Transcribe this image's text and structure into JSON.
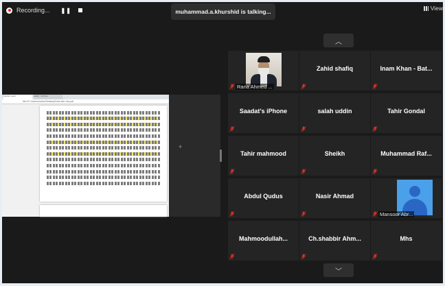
{
  "recording": {
    "label": "Recording..."
  },
  "talking": {
    "text": "muhammad.a.khurshid is talking..."
  },
  "view": {
    "label": "View"
  },
  "share": {
    "tabs": [
      "Vender result",
      "arabic - Archive"
    ],
    "url": "file:///C:/Users/mamz/Desktop/Dars-Abr-Yas.pdf"
  },
  "participants": [
    {
      "name": "Rana Ahmed ...",
      "type": "photo",
      "muted": true
    },
    {
      "name": "Zahid shafiq",
      "type": "name",
      "muted": true
    },
    {
      "name": "Inam Khan - Bat...",
      "type": "name",
      "muted": true
    },
    {
      "name": "Saadat’s iPhone",
      "type": "name",
      "muted": true
    },
    {
      "name": "salah uddin",
      "type": "name",
      "muted": true
    },
    {
      "name": "Tahir Gondal",
      "type": "name",
      "muted": true
    },
    {
      "name": "Tahir mahmood",
      "type": "name",
      "muted": true
    },
    {
      "name": "Sheikh",
      "type": "name",
      "muted": true
    },
    {
      "name": "Muhammad Raf...",
      "type": "name",
      "muted": true
    },
    {
      "name": "Abdul Qudus",
      "type": "name",
      "muted": true
    },
    {
      "name": "Nasir Ahmad",
      "type": "name",
      "muted": true
    },
    {
      "name": "Mansoor Abr...",
      "type": "avatar",
      "muted": true
    },
    {
      "name": "Mahmoodullah...",
      "type": "name",
      "muted": true
    },
    {
      "name": "Ch.shabbir Ahm...",
      "type": "name",
      "muted": true
    },
    {
      "name": "Mhs",
      "type": "name",
      "muted": true
    }
  ],
  "colors": {
    "mute_red": "#e0302a",
    "tile_bg": "#242424",
    "app_bg": "#1a1a1a"
  }
}
